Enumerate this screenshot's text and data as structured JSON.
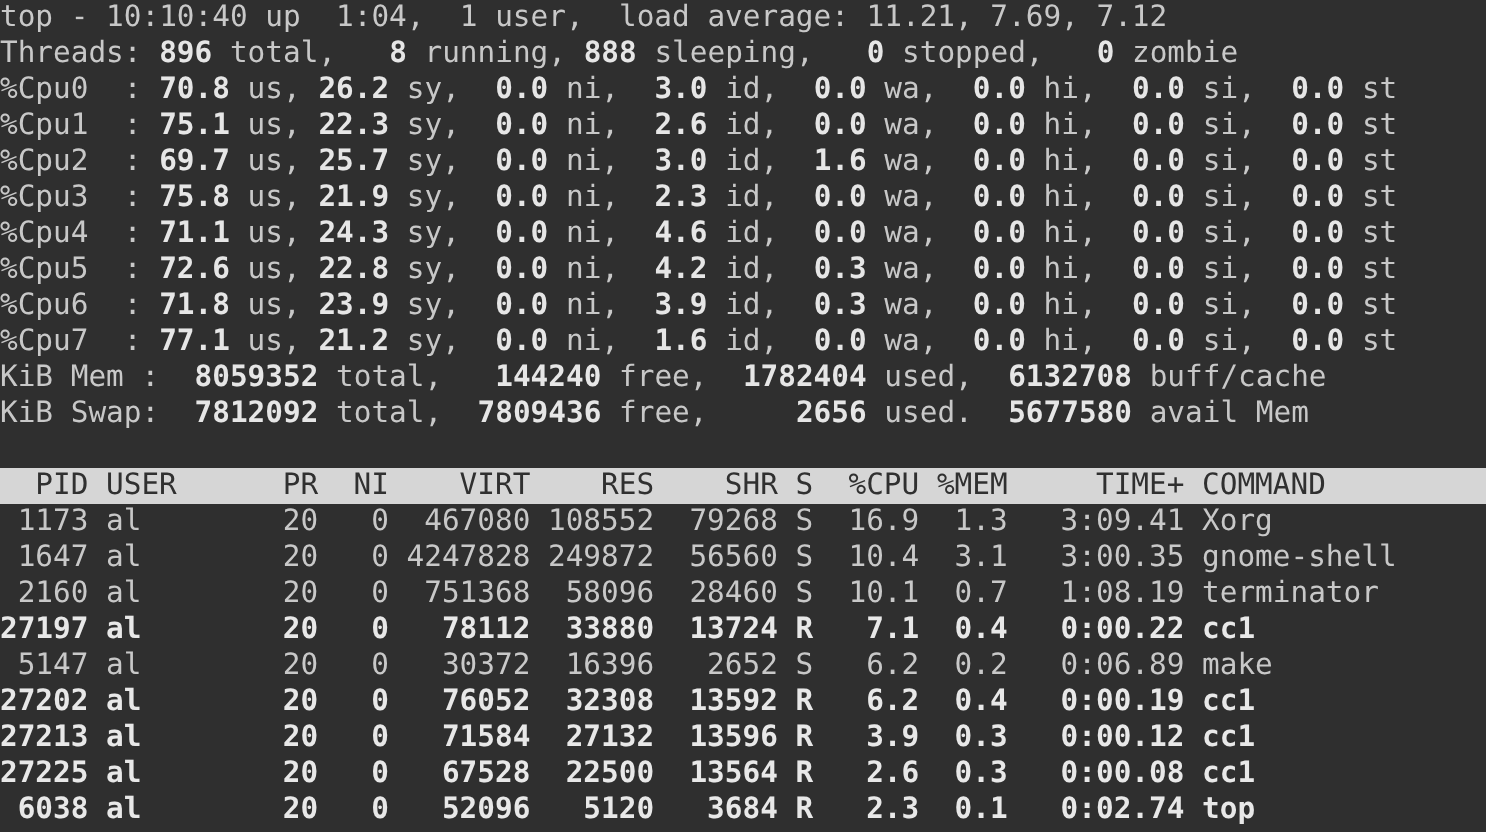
{
  "summary": [
    "top - 10:10:40 up  1:04,  1 user,  load average: 11.21, 7.69, 7.12",
    "Threads: **896** total,   **8** running, **888** sleeping,   **0** stopped,   **0** zombie",
    "%Cpu0  : **70.8** us, **26.2** sy,  **0.0** ni,  **3.0** id,  **0.0** wa,  **0.0** hi,  **0.0** si,  **0.0** st",
    "%Cpu1  : **75.1** us, **22.3** sy,  **0.0** ni,  **2.6** id,  **0.0** wa,  **0.0** hi,  **0.0** si,  **0.0** st",
    "%Cpu2  : **69.7** us, **25.7** sy,  **0.0** ni,  **3.0** id,  **1.6** wa,  **0.0** hi,  **0.0** si,  **0.0** st",
    "%Cpu3  : **75.8** us, **21.9** sy,  **0.0** ni,  **2.3** id,  **0.0** wa,  **0.0** hi,  **0.0** si,  **0.0** st",
    "%Cpu4  : **71.1** us, **24.3** sy,  **0.0** ni,  **4.6** id,  **0.0** wa,  **0.0** hi,  **0.0** si,  **0.0** st",
    "%Cpu5  : **72.6** us, **22.8** sy,  **0.0** ni,  **4.2** id,  **0.3** wa,  **0.0** hi,  **0.0** si,  **0.0** st",
    "%Cpu6  : **71.8** us, **23.9** sy,  **0.0** ni,  **3.9** id,  **0.3** wa,  **0.0** hi,  **0.0** si,  **0.0** st",
    "%Cpu7  : **77.1** us, **21.2** sy,  **0.0** ni,  **1.6** id,  **0.0** wa,  **0.0** hi,  **0.0** si,  **0.0** st",
    "KiB Mem :  **8059352** total,   **144240** free,  **1782404** used,  **6132708** buff/cache",
    "KiB Swap:  **7812092** total,  **7809436** free,     **2656** used.  **5677580** avail Mem"
  ],
  "table": {
    "columns": [
      "PID",
      "USER",
      "PR",
      "NI",
      "VIRT",
      "RES",
      "SHR",
      "S",
      "%CPU",
      "%MEM",
      "TIME+",
      "COMMAND"
    ],
    "rows": [
      {
        "bold": false,
        "cells": [
          "1173",
          "al",
          "20",
          "0",
          "467080",
          "108552",
          "79268",
          "S",
          "16.9",
          "1.3",
          "3:09.41",
          "Xorg"
        ]
      },
      {
        "bold": false,
        "cells": [
          "1647",
          "al",
          "20",
          "0",
          "4247828",
          "249872",
          "56560",
          "S",
          "10.4",
          "3.1",
          "3:00.35",
          "gnome-shell"
        ]
      },
      {
        "bold": false,
        "cells": [
          "2160",
          "al",
          "20",
          "0",
          "751368",
          "58096",
          "28460",
          "S",
          "10.1",
          "0.7",
          "1:08.19",
          "terminator"
        ]
      },
      {
        "bold": true,
        "cells": [
          "27197",
          "al",
          "20",
          "0",
          "78112",
          "33880",
          "13724",
          "R",
          "7.1",
          "0.4",
          "0:00.22",
          "cc1"
        ]
      },
      {
        "bold": false,
        "cells": [
          "5147",
          "al",
          "20",
          "0",
          "30372",
          "16396",
          "2652",
          "S",
          "6.2",
          "0.2",
          "0:06.89",
          "make"
        ]
      },
      {
        "bold": true,
        "cells": [
          "27202",
          "al",
          "20",
          "0",
          "76052",
          "32308",
          "13592",
          "R",
          "6.2",
          "0.4",
          "0:00.19",
          "cc1"
        ]
      },
      {
        "bold": true,
        "cells": [
          "27213",
          "al",
          "20",
          "0",
          "71584",
          "27132",
          "13596",
          "R",
          "3.9",
          "0.3",
          "0:00.12",
          "cc1"
        ]
      },
      {
        "bold": true,
        "cells": [
          "27225",
          "al",
          "20",
          "0",
          "67528",
          "22500",
          "13564",
          "R",
          "2.6",
          "0.3",
          "0:00.08",
          "cc1"
        ]
      },
      {
        "bold": true,
        "cells": [
          "6038",
          "al",
          "20",
          "0",
          "52096",
          "5120",
          "3684",
          "R",
          "2.3",
          "0.1",
          "0:02.74",
          "top"
        ]
      }
    ]
  }
}
